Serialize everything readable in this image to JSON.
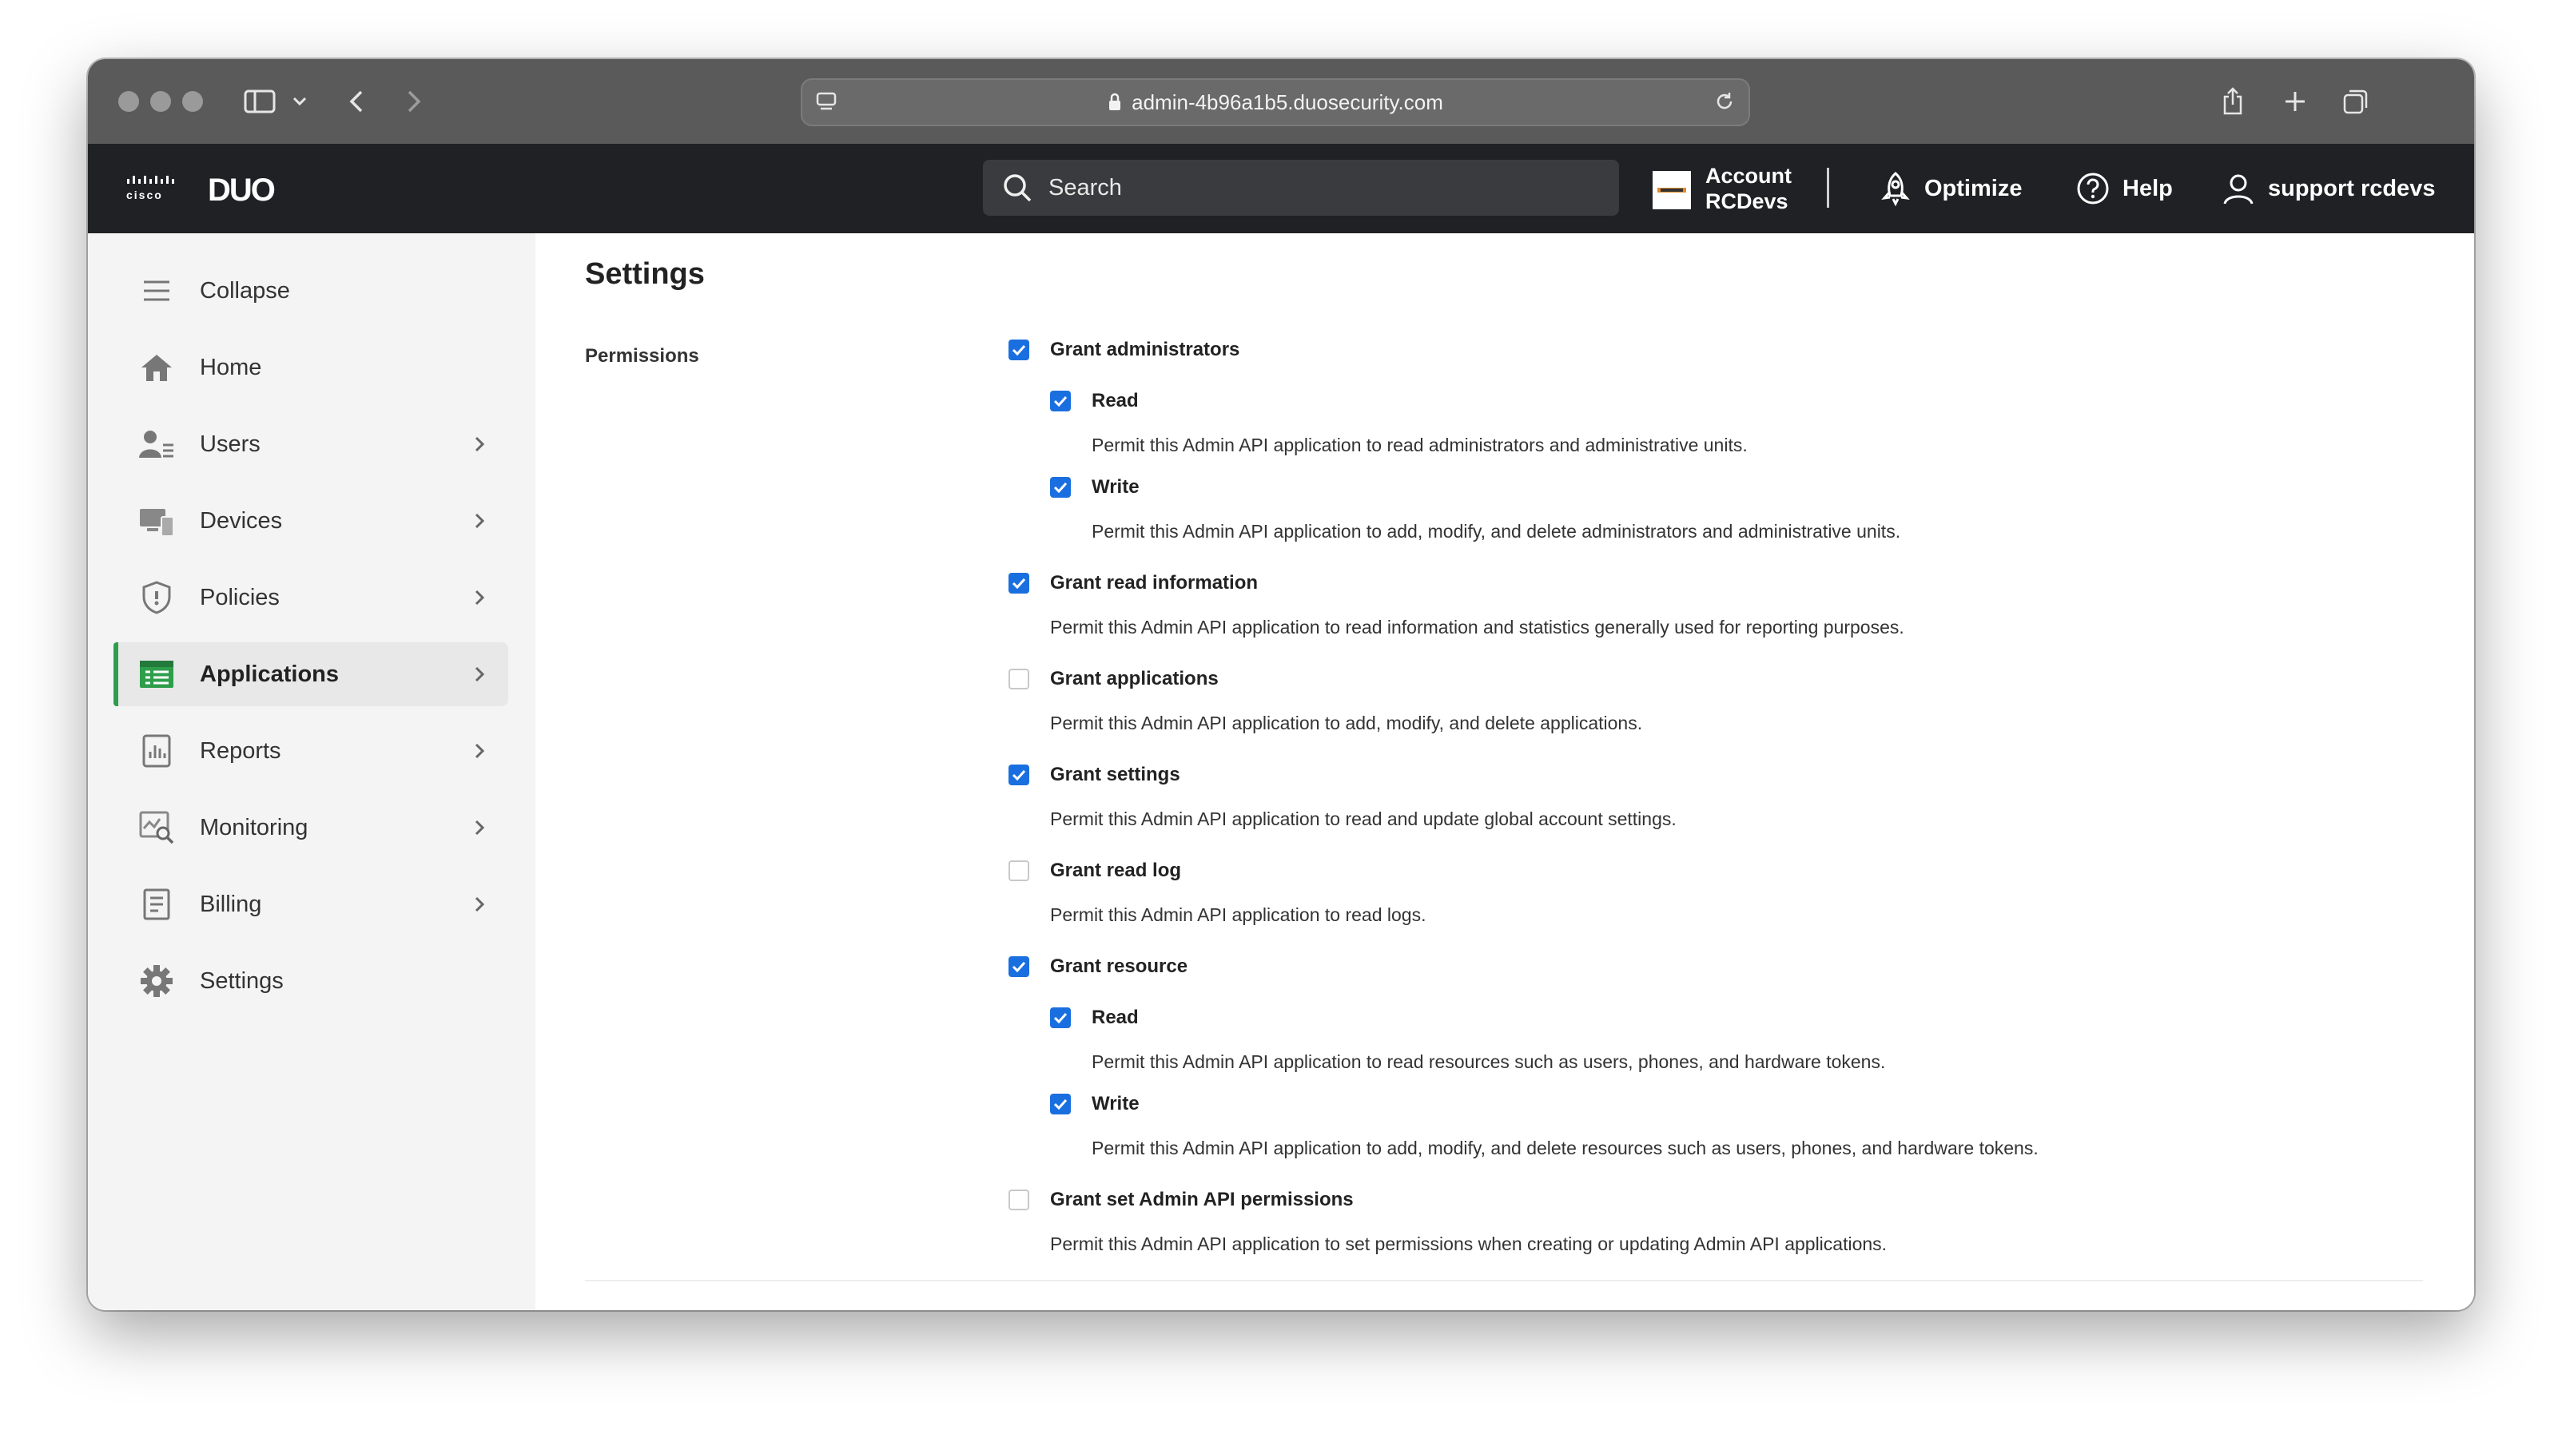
{
  "browser": {
    "url": "admin-4b96a1b5.duosecurity.com"
  },
  "header": {
    "cisco_logo": "cisco",
    "duo_logo": "DUO",
    "search_placeholder": "Search",
    "account_line1": "Account",
    "account_line2": "RCDevs",
    "optimize": "Optimize",
    "help": "Help",
    "user": "support rcdevs"
  },
  "sidebar": {
    "items": [
      {
        "label": "Collapse",
        "icon": "menu-icon",
        "chevron": false,
        "active": false
      },
      {
        "label": "Home",
        "icon": "home-icon",
        "chevron": false,
        "active": false
      },
      {
        "label": "Users",
        "icon": "users-icon",
        "chevron": true,
        "active": false
      },
      {
        "label": "Devices",
        "icon": "devices-icon",
        "chevron": true,
        "active": false
      },
      {
        "label": "Policies",
        "icon": "shield-icon",
        "chevron": true,
        "active": false
      },
      {
        "label": "Applications",
        "icon": "applications-icon",
        "chevron": true,
        "active": true
      },
      {
        "label": "Reports",
        "icon": "reports-icon",
        "chevron": true,
        "active": false
      },
      {
        "label": "Monitoring",
        "icon": "monitoring-icon",
        "chevron": true,
        "active": false
      },
      {
        "label": "Billing",
        "icon": "billing-icon",
        "chevron": true,
        "active": false
      },
      {
        "label": "Settings",
        "icon": "gear-icon",
        "chevron": false,
        "active": false
      }
    ]
  },
  "main": {
    "title": "Settings",
    "section_label": "Permissions",
    "permissions": [
      {
        "label": "Grant administrators",
        "checked": true,
        "desc": ""
      },
      {
        "label": "Read",
        "checked": true,
        "desc": "Permit this Admin API application to read administrators and administrative units."
      },
      {
        "label": "Write",
        "checked": true,
        "desc": "Permit this Admin API application to add, modify, and delete administrators and administrative units."
      },
      {
        "label": "Grant read information",
        "checked": true,
        "desc": "Permit this Admin API application to read information and statistics generally used for reporting purposes."
      },
      {
        "label": "Grant applications",
        "checked": false,
        "desc": "Permit this Admin API application to add, modify, and delete applications."
      },
      {
        "label": "Grant settings",
        "checked": true,
        "desc": "Permit this Admin API application to read and update global account settings."
      },
      {
        "label": "Grant read log",
        "checked": false,
        "desc": "Permit this Admin API application to read logs."
      },
      {
        "label": "Grant resource",
        "checked": true,
        "desc": ""
      },
      {
        "label": "Read",
        "checked": true,
        "desc": "Permit this Admin API application to read resources such as users, phones, and hardware tokens."
      },
      {
        "label": "Write",
        "checked": true,
        "desc": "Permit this Admin API application to add, modify, and delete resources such as users, phones, and hardware tokens."
      },
      {
        "label": "Grant set Admin API permissions",
        "checked": false,
        "desc": "Permit this Admin API application to set permissions when creating or updating Admin API applications."
      }
    ]
  },
  "colors": {
    "accent_blue": "#1a6fe0",
    "active_green": "#2e9e4b",
    "header_bg": "#202124"
  }
}
